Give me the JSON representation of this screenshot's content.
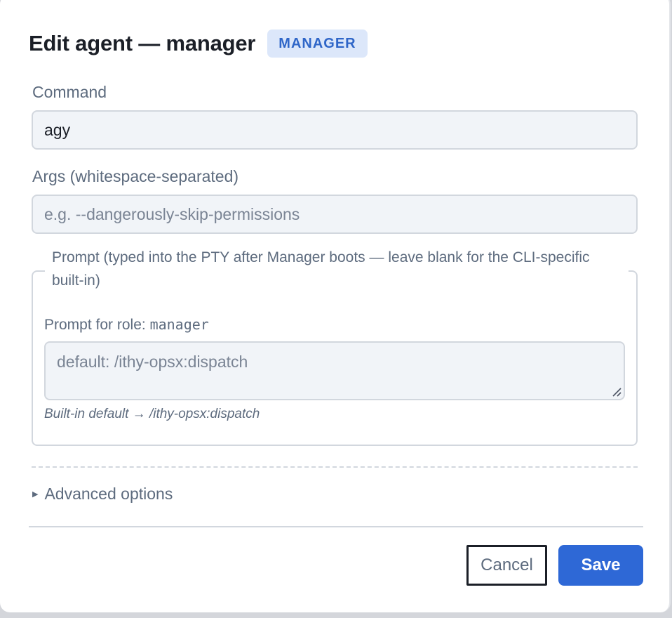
{
  "dialog": {
    "title": "Edit agent — manager",
    "role_badge": "MANAGER"
  },
  "command": {
    "label": "Command",
    "value": "agy"
  },
  "args": {
    "label": "Args (whitespace-separated)",
    "value": "",
    "placeholder": "e.g. --dangerously-skip-permissions"
  },
  "prompt": {
    "legend": "Prompt (typed into the PTY after Manager boots — leave blank for the CLI-specific built-in)",
    "role_label_prefix": "Prompt for role: ",
    "role_name": "manager",
    "value": "",
    "placeholder": "default: /ithy-opsx:dispatch",
    "hint": "Built-in default → /ithy-opsx:dispatch"
  },
  "advanced": {
    "label": "Advanced options",
    "expanded": false
  },
  "footer": {
    "cancel_label": "Cancel",
    "save_label": "Save"
  },
  "colors": {
    "accent": "#2e68d6",
    "badge_bg": "#dce7fa",
    "badge_text": "#2f66c8",
    "muted_text": "#5d6b7e",
    "input_bg": "#f1f4f8",
    "border": "#d2d7de"
  }
}
